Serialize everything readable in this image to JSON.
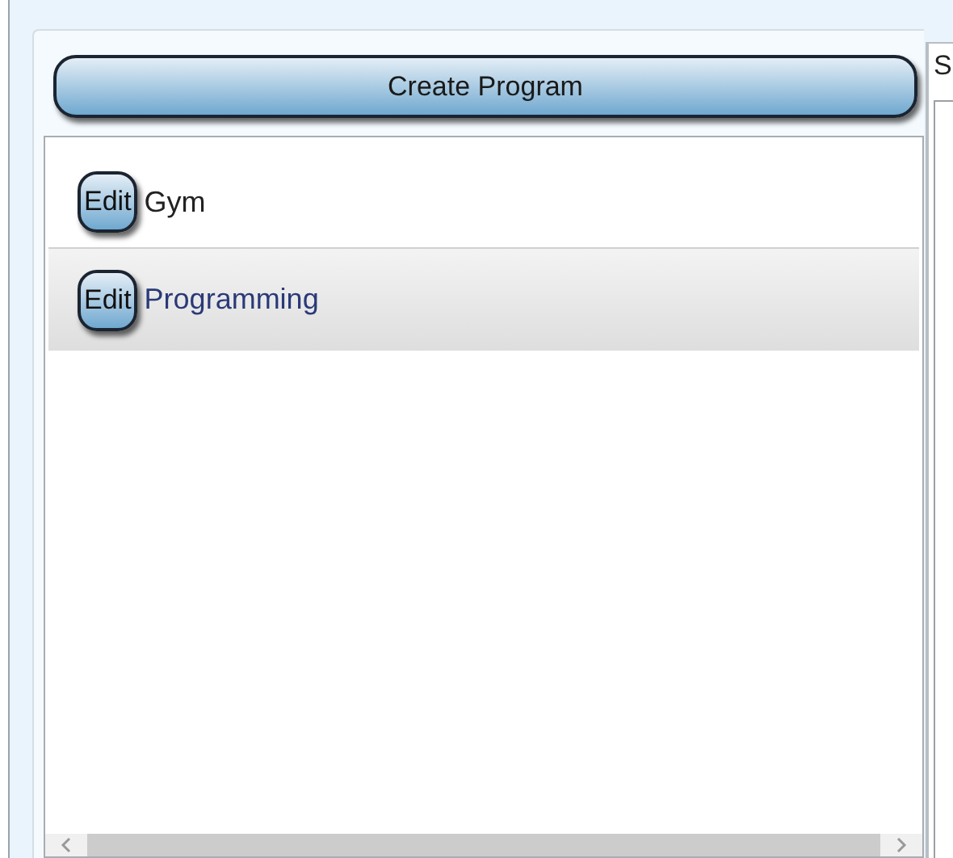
{
  "create_button": {
    "label": "Create Program"
  },
  "programs": [
    {
      "edit_label": "Edit",
      "name": "Gym",
      "selected": false
    },
    {
      "edit_label": "Edit",
      "name": "Programming",
      "selected": true
    }
  ],
  "side_panel": {
    "header": "S"
  }
}
